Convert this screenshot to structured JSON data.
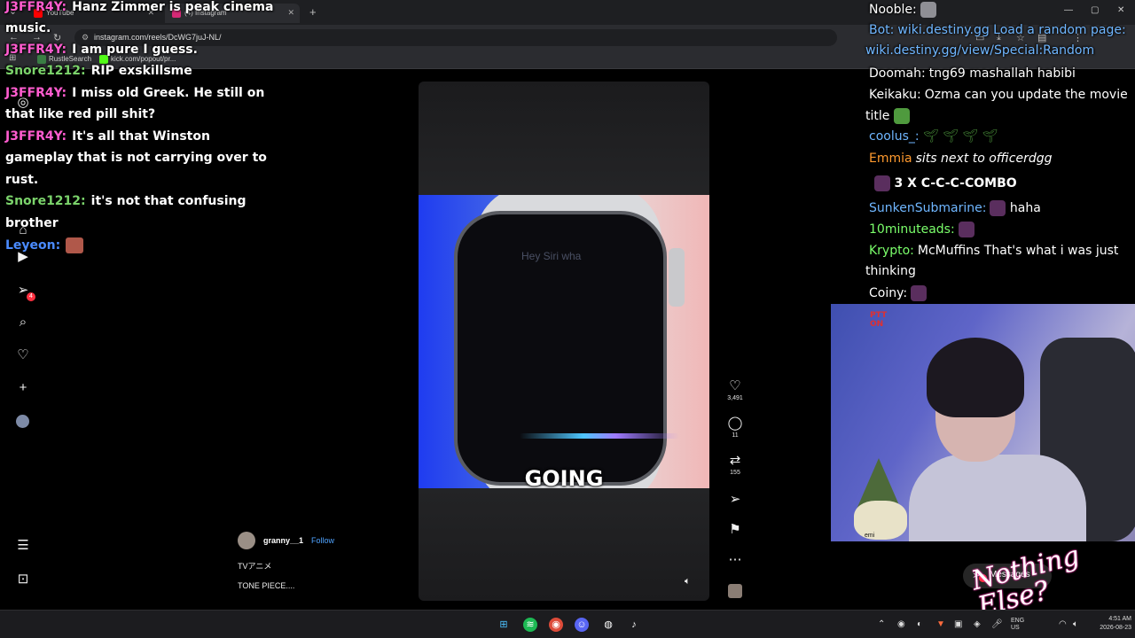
{
  "browser": {
    "tabs": [
      {
        "label": "YouTube",
        "color": "#ff0000"
      },
      {
        "label": "(4) Instagram",
        "color": "#d62976"
      }
    ],
    "url": "instagram.com/reels/DcWG7juJ-NL/",
    "bookmarks": [
      {
        "label": "RustleSearch",
        "color": "#3a7d44"
      },
      {
        "label": "kick.com/popout/pr...",
        "color": "#53fc18"
      }
    ]
  },
  "instagram": {
    "nav": {
      "notification_badge": "4",
      "messages_badge": "4"
    },
    "reel": {
      "watch_text": "Hey Siri wha",
      "caption": "GOING",
      "author": "granny__1",
      "follow": "Follow",
      "description_line1": "TVアニメ",
      "description_line2": "TONE PIECE...."
    },
    "actions": {
      "likes": "3,491",
      "comments": "11",
      "reposts": "155"
    },
    "messages_label": "Messages"
  },
  "chat_left": [
    {
      "user": "J3FFR4Y:",
      "user_color": "#ff5ccf",
      "text": "Hanz Zimmer is peak cinema"
    },
    {
      "user": "",
      "user_color": "#ffffff",
      "text": "music."
    },
    {
      "user": "J3FFR4Y:",
      "user_color": "#ff5ccf",
      "text": "I am pure I guess."
    },
    {
      "user": "Snore1212:",
      "user_color": "#7bd36b",
      "text": "RIP exskillsme"
    },
    {
      "user": "J3FFR4Y:",
      "user_color": "#ff5ccf",
      "text": "I miss old Greek. He still on"
    },
    {
      "user": "",
      "user_color": "#ffffff",
      "text": "that like red pill shit?"
    },
    {
      "user": "J3FFR4Y:",
      "user_color": "#ff5ccf",
      "text": "It's all that Winston"
    },
    {
      "user": "",
      "user_color": "#ffffff",
      "text": "gameplay that is not carrying over to"
    },
    {
      "user": "",
      "user_color": "#ffffff",
      "text": "rust."
    },
    {
      "user": "Snore1212:",
      "user_color": "#7bd36b",
      "text": "it's not that confusing"
    },
    {
      "user": "",
      "user_color": "#ffffff",
      "text": "brother"
    },
    {
      "user": "Leyeon:",
      "user_color": "#4a8bff",
      "text": ""
    }
  ],
  "chat_right": [
    {
      "user": "Nooble:",
      "user_color": "#ffffff",
      "text": ""
    },
    {
      "user": "Bot:",
      "user_color": "#6fb6ff",
      "text": "wiki.destiny.gg Load a random page:"
    },
    {
      "user": "",
      "user_color": "#ffffff",
      "text": "wiki.destiny.gg/view/Special:Random"
    },
    {
      "user": "Doomah:",
      "user_color": "#ffffff",
      "text": "tng69 mashallah habibi"
    },
    {
      "user": "Keikaku:",
      "user_color": "#ffffff",
      "text": "Ozma can you update the movie"
    },
    {
      "user": "",
      "user_color": "#ffffff",
      "text": "title"
    },
    {
      "user": "coolus_:",
      "user_color": "#6fb6ff",
      "text": ""
    },
    {
      "user": "Emmia",
      "user_color": "#ff9a2e",
      "text": "sits next to officerdgg"
    },
    {
      "user": "",
      "user_color": "#ffffff",
      "text": "3 X C-C-C-COMBO"
    },
    {
      "user": "SunkenSubmarine:",
      "user_color": "#6fb6ff",
      "text": "haha"
    },
    {
      "user": "10minuteads:",
      "user_color": "#7bff6b",
      "text": ""
    },
    {
      "user": "Krypto:",
      "user_color": "#7bff6b",
      "text": "McMuffins That's what i was just"
    },
    {
      "user": "",
      "user_color": "#ffffff",
      "text": "thinking"
    },
    {
      "user": "Coiny:",
      "user_color": "#ffffff",
      "text": ""
    }
  ],
  "webcam": {
    "sign_text": "PTT ON",
    "gnome_label": "emi"
  },
  "overlay_brand": "Nothing Else?",
  "taskbar": {
    "lang": "ENG",
    "region": "US",
    "time": "4:51 AM",
    "date": "2026-08-23"
  }
}
